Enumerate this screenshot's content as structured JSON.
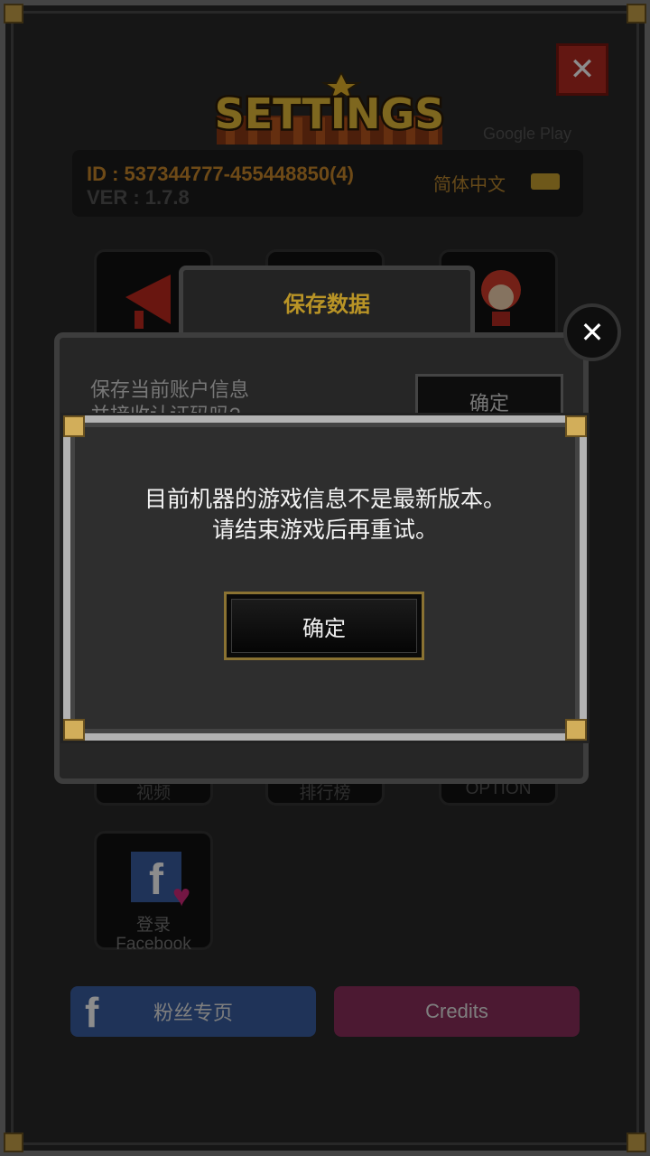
{
  "header": {
    "title": "SETTINGS",
    "google_play": "Google Play"
  },
  "account": {
    "id": "ID : 537344777-455448850(4)",
    "version": "VER : 1.7.8",
    "language": "简体中文"
  },
  "tiles": {
    "tile4_label": "视频",
    "tile5_label": "排行榜",
    "tile6_label": "OPTION",
    "facebook_login_label_1": "登录",
    "facebook_login_label_2": "Facebook"
  },
  "save_panel": {
    "title": "保存数据",
    "text_line1": "保存当前账户信息",
    "text_line2": "并接收认证码吗?",
    "confirm": "确定"
  },
  "dialog": {
    "line1": "目前机器的游戏信息不是最新版本。",
    "line2": "请结束游戏后再重试。",
    "confirm": "确定"
  },
  "bottom": {
    "fan_page": "粉丝专页",
    "credits": "Credits"
  },
  "colors": {
    "gold": "#c9a24a",
    "facebook_blue": "#3a5ea0",
    "credits_pink": "#8b2f5c",
    "close_red": "#b52a22"
  }
}
